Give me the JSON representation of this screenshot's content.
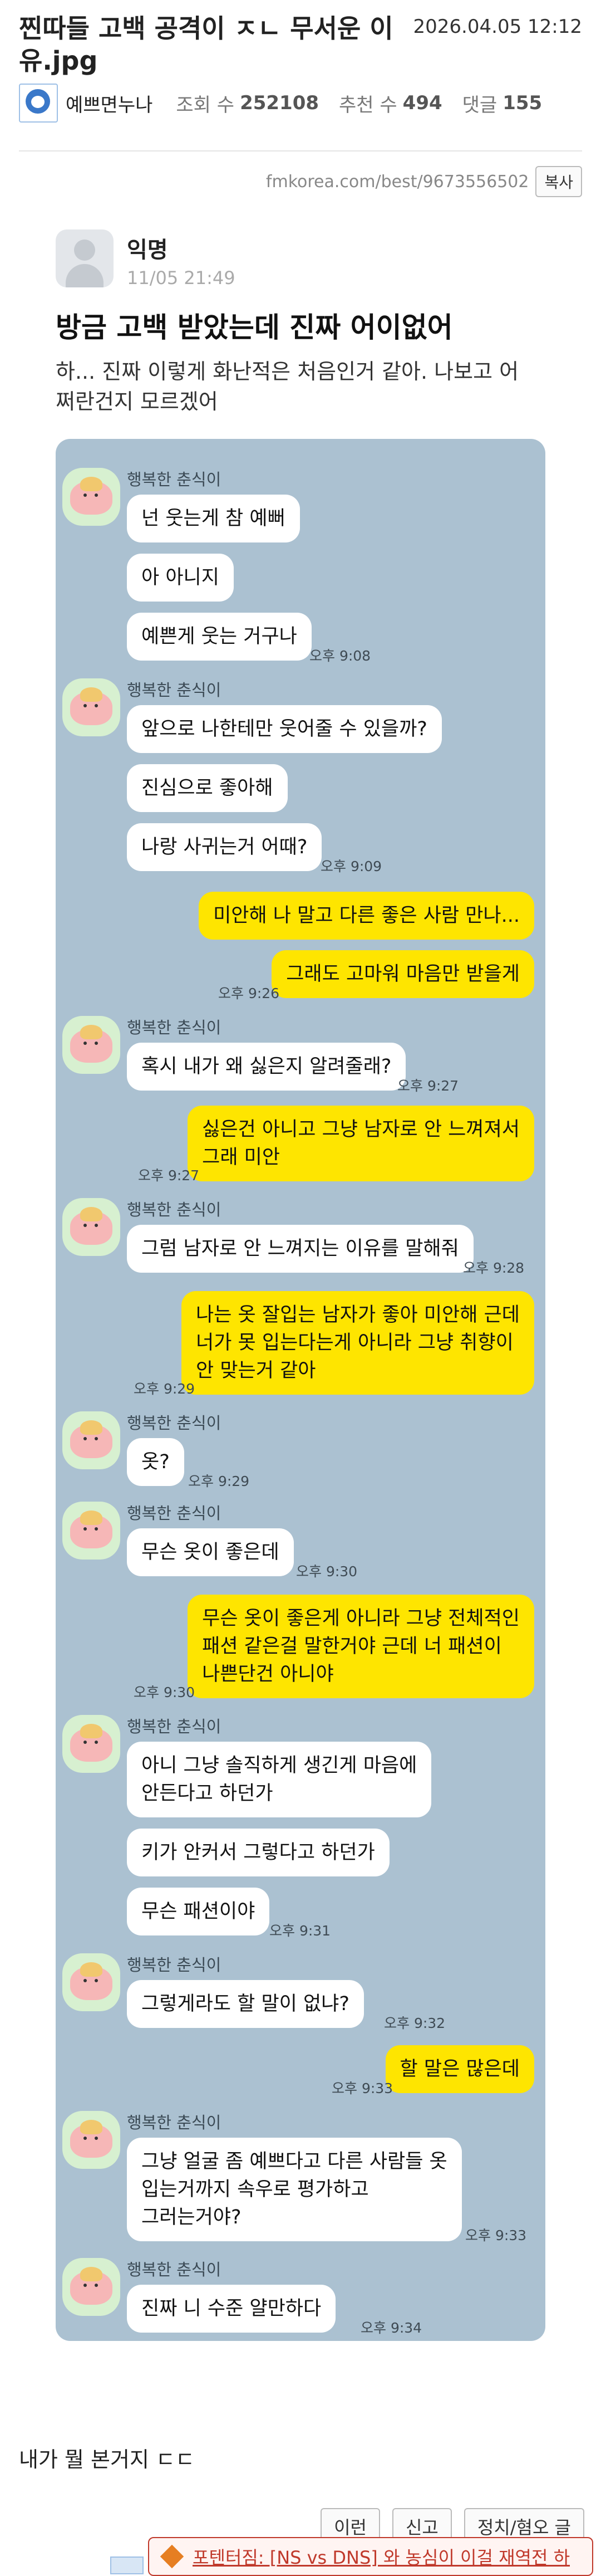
{
  "post": {
    "title": "찐따들 고백 공격이 ㅈㄴ 무서운 이유.jpg",
    "date": "2026.04.05 12:12",
    "author": "예쁘면누나",
    "views_label": "조회 수",
    "views": "252108",
    "likes_label": "추천 수",
    "likes": "494",
    "comments_label": "댓글",
    "comments": "155",
    "source_url": "fmkorea.com/best/9673556502",
    "copy_label": "복사"
  },
  "embed": {
    "user": "익명",
    "time": "11/05 21:49",
    "title": "방금 고백 받았는데 진짜 어이없어",
    "body": "하... 진짜 이렇게 화난적은 처음인거 같아. 나보고 어쩌란건지 모르겠어"
  },
  "chat": {
    "sender": "행복한 춘식이",
    "m1": "넌 웃는게 참 예뻐",
    "m2": "아 아니지",
    "m3": "예쁜게 웃는 거구나",
    "t1": "오후 9:08",
    "m4": "앞으로 나한테만 웃어줄 수 있을까?",
    "m5": "진심으로 좋아해",
    "m6": "나랑 사귀는거 어때?",
    "t2": "오후 9:09",
    "m7": "미안해 나 말고 다른 좋은 사람 만나...",
    "m8": "그래도 고마워 마음만 받을게",
    "t3": "오후 9:26",
    "m9": "혹시 내가 왜 싫은지 알려줄래?",
    "t4": "오후 9:27",
    "m10": "싫은건 아니고 그냥 남자로 안 느껴져서\n그래 미안",
    "t5": "오후 9:27",
    "m11": "그럼 남자로 안 느껴지는 이유를 말해줘",
    "t6": "오후 9:28",
    "m12": "나는 옷 잘입는 남자가 좋아 미안해 근데\n너가 못 입는다는게 아니라 그냥 취향이\n안 맞는거 같아",
    "t7": "오후 9:29",
    "m13": "옷?",
    "t8": "오후 9:29",
    "m14": "무슨 옷이 좋은데",
    "t9": "오후 9:30",
    "m15": "무슨 옷이 좋은게 아니라 그냥 전체적인\n패션 같은걸 말한거야 근데 너 패션이\n나쁜단건 아니야",
    "t10": "오후 9:30",
    "m16": "아니 그냥 솔직하게 생긴게 마음에\n안든다고 하던가",
    "m17": "키가 안커서 그렇다고 하던가",
    "m18": "무슨 패션이야",
    "t11": "오후 9:31",
    "m19": "그렇게라도 할 말이 없냐?",
    "t12": "오후 9:32",
    "m20": "할 말은 많은데",
    "t13": "오후 9:33",
    "m21": "그냥 얼굴 좀 예쁘다고 다른 사람들 옷\n입는거까지 속우로 평가하고\n그러는거야?",
    "t14": "오후 9:33",
    "m22": "진짜 니 수준 얄만하다",
    "t15": "오후 9:34"
  },
  "footer": {
    "text": "내가 뭘 본거지 ㄷㄷ",
    "btn1": "이런",
    "btn2": "신고",
    "btn3": "정치/혐오 글",
    "notice": "포텐터짐: [NS vs DNS] 와 농심이 이걸 재역전 하"
  }
}
